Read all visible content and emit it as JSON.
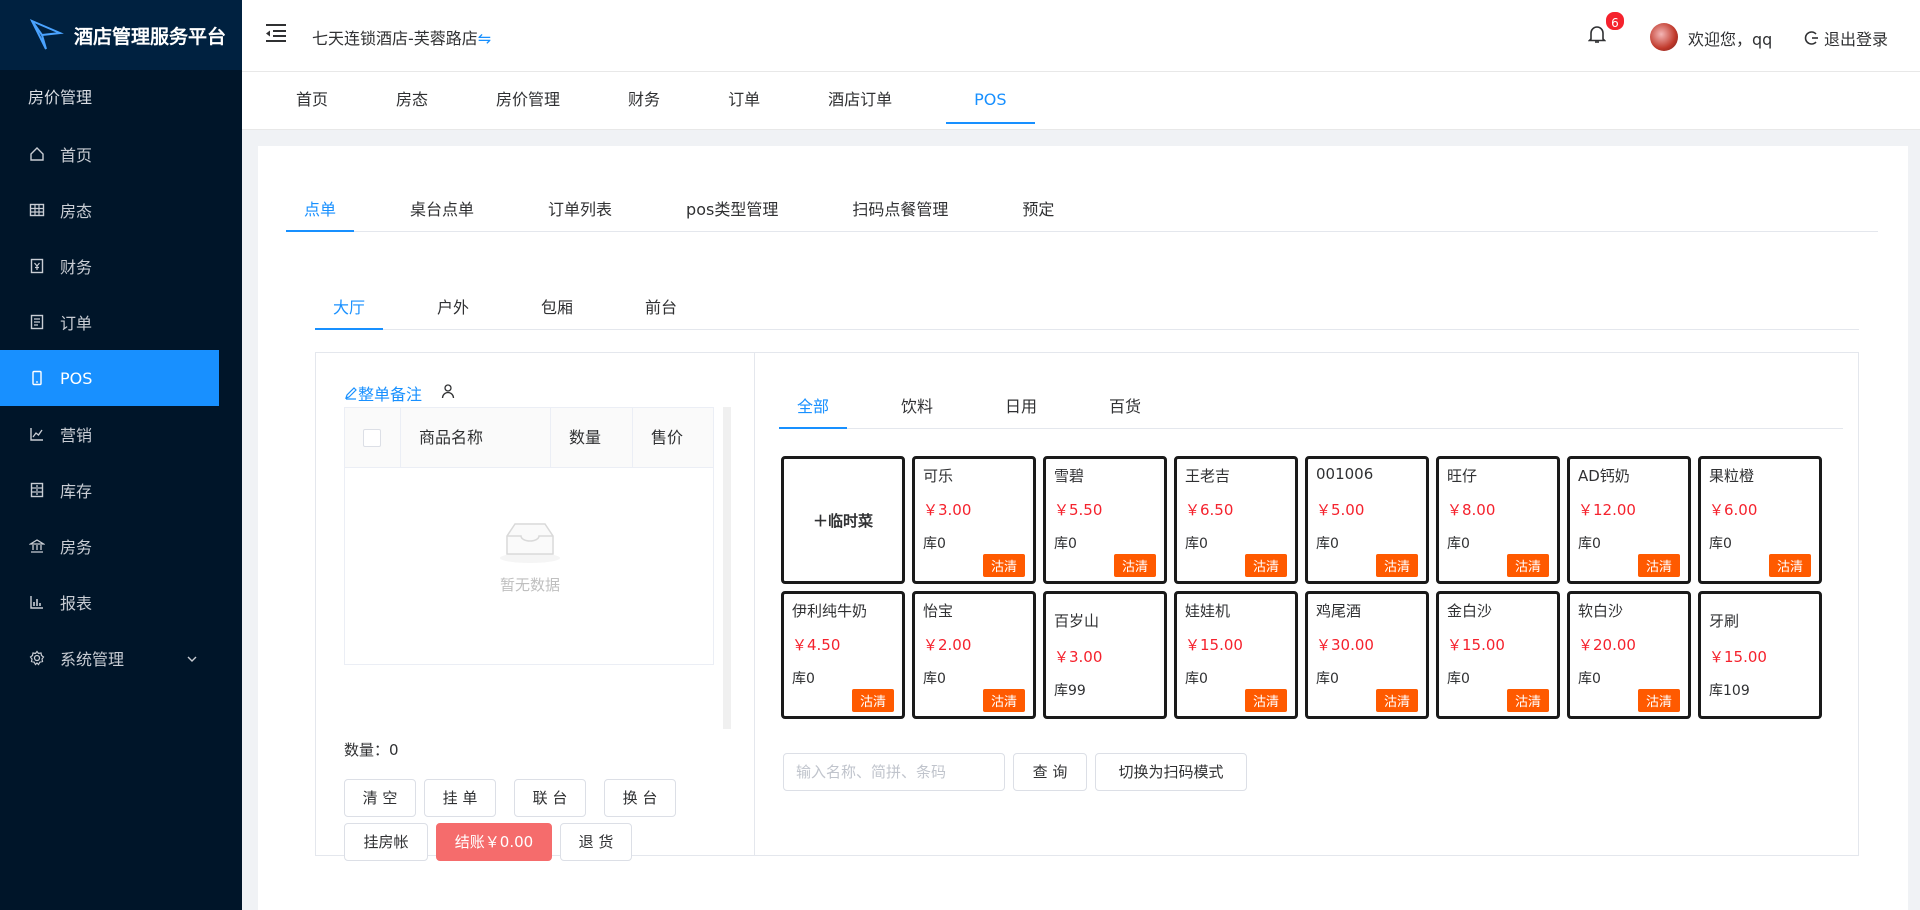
{
  "app": {
    "title": "酒店管理服务平台"
  },
  "sidebar": {
    "group_label": "房价管理",
    "items": [
      {
        "label": "首页",
        "icon": "home-icon"
      },
      {
        "label": "房态",
        "icon": "grid-icon"
      },
      {
        "label": "财务",
        "icon": "finance-icon"
      },
      {
        "label": "订单",
        "icon": "order-icon"
      },
      {
        "label": "POS",
        "icon": "mobile-icon",
        "active": true
      },
      {
        "label": "营销",
        "icon": "chart-line-icon"
      },
      {
        "label": "库存",
        "icon": "inventory-icon"
      },
      {
        "label": "房务",
        "icon": "bank-icon"
      },
      {
        "label": "报表",
        "icon": "bar-chart-icon"
      },
      {
        "label": "系统管理",
        "icon": "gear-icon"
      }
    ]
  },
  "header": {
    "hotel_name": "七天连锁酒店-芙蓉路店",
    "swap_glyph": "⇋",
    "notification_count": "6",
    "welcome": "欢迎您，qq",
    "logout": "退出登录"
  },
  "top_tabs": [
    "首页",
    "房态",
    "房价管理",
    "财务",
    "订单",
    "酒店订单",
    "POS"
  ],
  "sub_tabs": [
    "点单",
    "桌台点单",
    "订单列表",
    "pos类型管理",
    "扫码点餐管理",
    "预定"
  ],
  "area_tabs": [
    "大厅",
    "户外",
    "包厢",
    "前台"
  ],
  "order_panel": {
    "remark": "整单备注",
    "columns": [
      "商品名称",
      "数量",
      "售价"
    ],
    "empty_text": "暂无数据",
    "quantity_label": "数量：0",
    "buttons": {
      "clear": "清 空",
      "hold": "挂 单",
      "join": "联 台",
      "switch": "换 台",
      "room_charge": "挂房帐",
      "checkout": "结账￥0.00",
      "refund": "退 货"
    }
  },
  "product_panel": {
    "category_tabs": [
      "全部",
      "饮料",
      "日用",
      "百货"
    ],
    "temp_dish": "＋临时菜",
    "products": [
      {
        "name": "可乐",
        "price": "￥3.00",
        "stock": "库0",
        "sold_out": "沽清"
      },
      {
        "name": "雪碧",
        "price": "￥5.50",
        "stock": "库0",
        "sold_out": "沽清"
      },
      {
        "name": "王老吉",
        "price": "￥6.50",
        "stock": "库0",
        "sold_out": "沽清"
      },
      {
        "name": "001006",
        "price": "￥5.00",
        "stock": "库0",
        "sold_out": "沽清"
      },
      {
        "name": "旺仔",
        "price": "￥8.00",
        "stock": "库0",
        "sold_out": "沽清"
      },
      {
        "name": "AD钙奶",
        "price": "￥12.00",
        "stock": "库0",
        "sold_out": "沽清"
      },
      {
        "name": "果粒橙",
        "price": "￥6.00",
        "stock": "库0",
        "sold_out": "沽清"
      },
      {
        "name": "伊利纯牛奶",
        "price": "￥4.50",
        "stock": "库0",
        "sold_out": "沽清"
      },
      {
        "name": "怡宝",
        "price": "￥2.00",
        "stock": "库0",
        "sold_out": "沽清"
      },
      {
        "name": "百岁山",
        "price": "￥3.00",
        "stock": "库99",
        "sold_out": ""
      },
      {
        "name": "娃娃机",
        "price": "￥15.00",
        "stock": "库0",
        "sold_out": "沽清"
      },
      {
        "name": "鸡尾酒",
        "price": "￥30.00",
        "stock": "库0",
        "sold_out": "沽清"
      },
      {
        "name": "金白沙",
        "price": "￥15.00",
        "stock": "库0",
        "sold_out": "沽清"
      },
      {
        "name": "软白沙",
        "price": "￥20.00",
        "stock": "库0",
        "sold_out": "沽清"
      },
      {
        "name": "牙刷",
        "price": "￥15.00",
        "stock": "库109",
        "sold_out": ""
      }
    ],
    "search_placeholder": "输入名称、简拼、条码",
    "query_button": "查 询",
    "scan_mode_button": "切换为扫码模式"
  },
  "colors": {
    "primary": "#1890ff",
    "sidebar_bg": "#001529",
    "sold_out": "#ff5a00",
    "price": "#f5222d",
    "checkout": "#f56c6c"
  }
}
